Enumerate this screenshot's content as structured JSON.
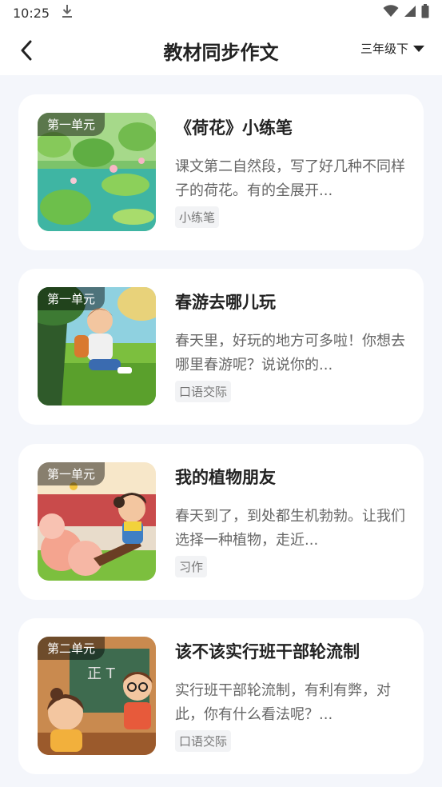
{
  "status_bar": {
    "time": "10:25",
    "icons": [
      "download-icon",
      "wifi-icon",
      "signal-icon",
      "battery-icon"
    ]
  },
  "header": {
    "back_icon": "chevron-left-icon",
    "title": "教材同步作文",
    "grade_selector": "三年级下",
    "grade_dropdown_icon": "triangle-down-icon"
  },
  "cards": [
    {
      "unit": "第一单元",
      "title": "《荷花》小练笔",
      "description": "课文第二自然段，写了好几种不同样子的荷花。有的全展开...",
      "tag": "小练笔",
      "thumbnail": "lotus-pond-illustration"
    },
    {
      "unit": "第一单元",
      "title": "春游去哪儿玩",
      "description": "春天里，好玩的地方可多啦！你想去哪里春游呢？说说你的...",
      "tag": "口语交际",
      "thumbnail": "boy-in-spring-park-illustration"
    },
    {
      "unit": "第一单元",
      "title": "我的植物朋友",
      "description": "春天到了，到处都生机勃勃。让我们选择一种植物，走近...",
      "tag": "习作",
      "thumbnail": "girl-with-flowers-illustration"
    },
    {
      "unit": "第二单元",
      "title": "该不该实行班干部轮流制",
      "description": "实行班干部轮流制，有利有弊，对此，你有什么看法呢？...",
      "tag": "口语交际",
      "thumbnail": "classroom-students-illustration"
    }
  ]
}
